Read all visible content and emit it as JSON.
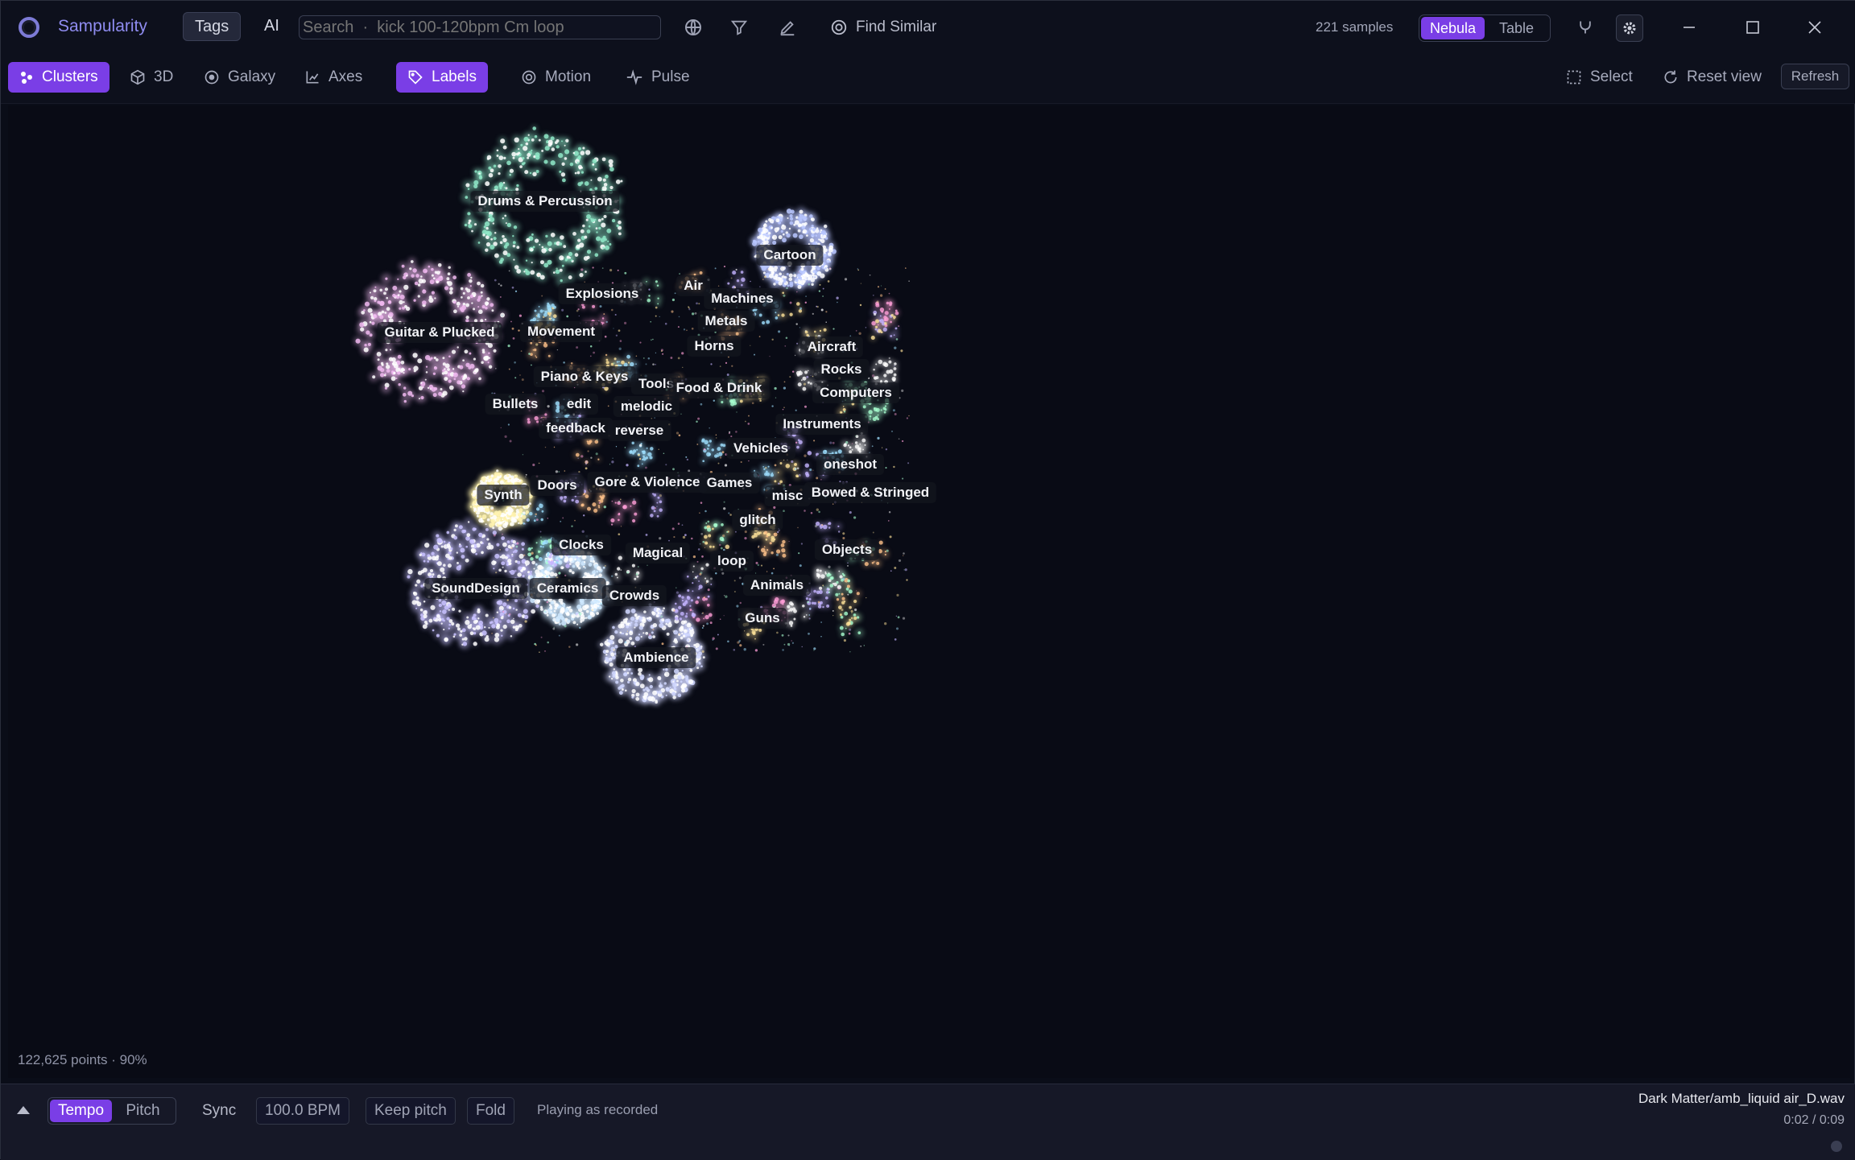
{
  "app": {
    "name": "Sampularity"
  },
  "header": {
    "tabs": [
      {
        "label": "Tags",
        "active": true
      },
      {
        "label": "AI",
        "active": false
      }
    ],
    "search": {
      "value": "",
      "placeholder": "Search  ·  kick 100-120bpm Cm loop"
    },
    "find_similar": "Find Similar",
    "samples_count": "221 samples",
    "view_toggle": [
      {
        "label": "Nebula",
        "active": true
      },
      {
        "label": "Table",
        "active": false
      }
    ]
  },
  "toolbar": {
    "clusters": "Clusters",
    "threed": "3D",
    "galaxy": "Galaxy",
    "axes": "Axes",
    "labels": "Labels",
    "motion": "Motion",
    "pulse": "Pulse",
    "select": "Select",
    "reset_view": "Reset view",
    "refresh": "Refresh"
  },
  "canvas": {
    "points_info": "122,625 points  ·  90%",
    "labels": [
      {
        "text": "Drums & Percussion"
      },
      {
        "text": "Cartoon"
      },
      {
        "text": "Air"
      },
      {
        "text": "Explosions"
      },
      {
        "text": "Machines"
      },
      {
        "text": "Metals"
      },
      {
        "text": "Guitar & Plucked"
      },
      {
        "text": "Movement"
      },
      {
        "text": "Horns"
      },
      {
        "text": "Aircraft"
      },
      {
        "text": "Rocks"
      },
      {
        "text": "Piano & Keys"
      },
      {
        "text": "Tools"
      },
      {
        "text": "Food & Drink"
      },
      {
        "text": "Computers"
      },
      {
        "text": "Bullets"
      },
      {
        "text": "edit"
      },
      {
        "text": "melodic"
      },
      {
        "text": "feedback"
      },
      {
        "text": "reverse"
      },
      {
        "text": "Instruments"
      },
      {
        "text": "Vehicles"
      },
      {
        "text": "oneshot"
      },
      {
        "text": "Synth"
      },
      {
        "text": "Doors"
      },
      {
        "text": "Gore & Violence"
      },
      {
        "text": "Games"
      },
      {
        "text": "misc"
      },
      {
        "text": "Bowed & Stringed"
      },
      {
        "text": "glitch"
      },
      {
        "text": "Clocks"
      },
      {
        "text": "Magical"
      },
      {
        "text": "loop"
      },
      {
        "text": "Objects"
      },
      {
        "text": "SoundDesign"
      },
      {
        "text": "Ceramics"
      },
      {
        "text": "Crowds"
      },
      {
        "text": "Animals"
      },
      {
        "text": "Guns"
      },
      {
        "text": "Ambience"
      }
    ]
  },
  "player": {
    "modes": [
      {
        "label": "Tempo",
        "active": true
      },
      {
        "label": "Pitch",
        "active": false
      }
    ],
    "sync": "Sync",
    "bpm": "100.0 BPM",
    "keep_pitch": "Keep pitch",
    "fold": "Fold",
    "status": "Playing as recorded",
    "now_playing": "Dark Matter/amb_liquid air_D.wav",
    "time": "0:02  /  0:09"
  },
  "colors": {
    "accent": "#7a3ee6",
    "brand": "#8f8cf0",
    "background": "#090b15"
  }
}
